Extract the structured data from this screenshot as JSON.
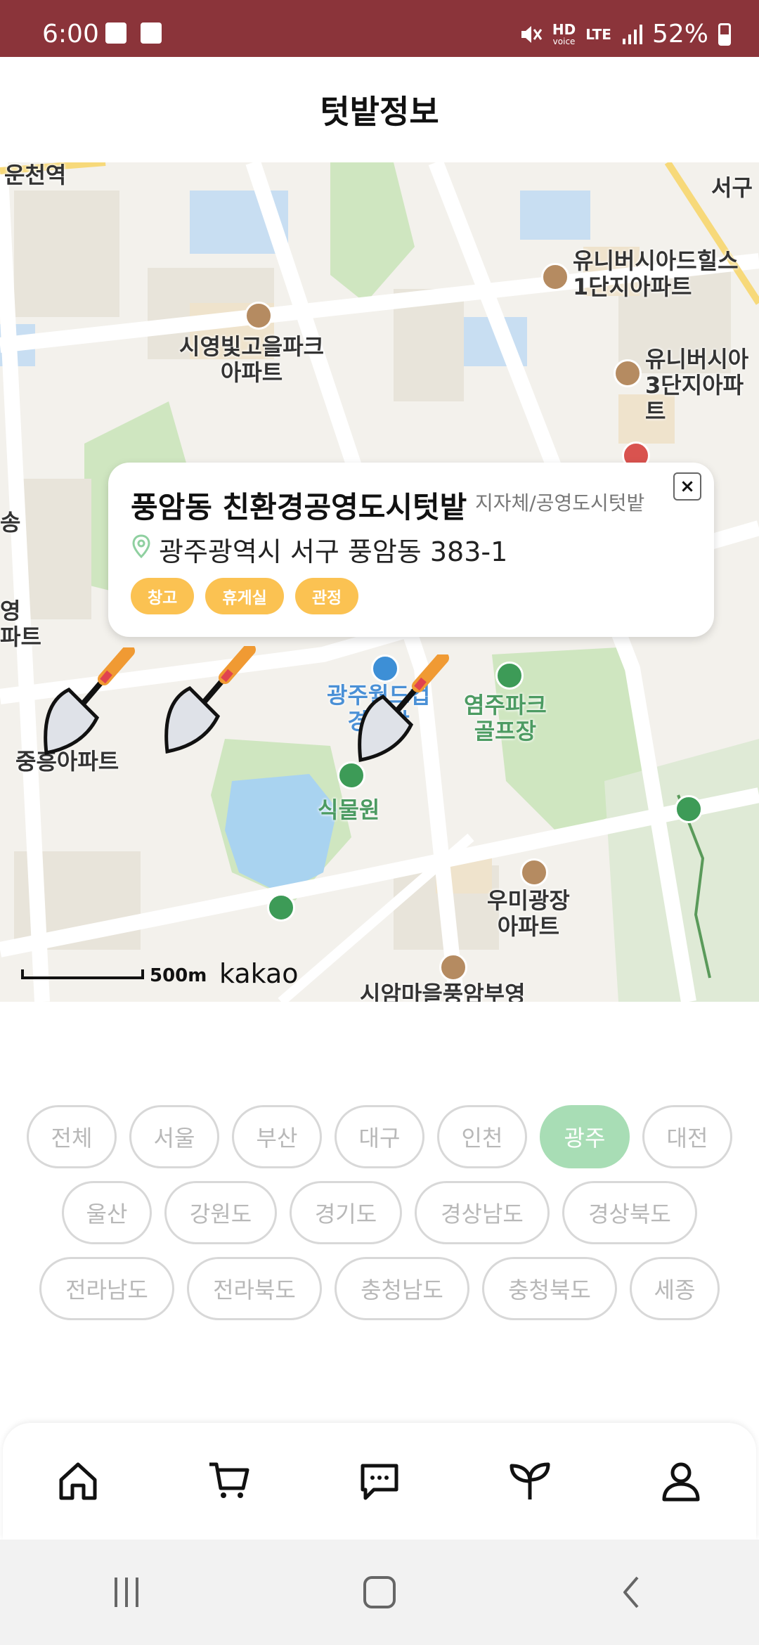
{
  "status_bar": {
    "time": "6:00",
    "hd_label": "HD",
    "voice_label": "voice",
    "lte_label": "LTE",
    "battery": "52%"
  },
  "header": {
    "title": "텃밭정보"
  },
  "map": {
    "labels": {
      "station": "운천역",
      "apt1": "시영빛고을파크\n아파트",
      "apt2": "유니버시아드힐스\n1단지아파트",
      "apt3": "유니버시아\n3단지아파트",
      "left1": "송",
      "left2": "영\n파트",
      "apt4": "중흥아파트",
      "stadium": "광주월드컵\n경기장",
      "golf": "염주파크\n골프장",
      "botanical": "식물원",
      "apt5": "우미광장\n아파트",
      "bottom_station": "시암마을풍암부영",
      "top_right": "서구"
    },
    "scale": "500m",
    "brand": "kakao"
  },
  "popup": {
    "name": "풍암동 친환경공영도시텃밭",
    "category": "지자체/공영도시텃밭",
    "address": "광주광역시 서구 풍암동 383-1",
    "close_icon": "×",
    "tags": [
      "창고",
      "휴게실",
      "관정"
    ]
  },
  "regions": {
    "row1": [
      "전체",
      "서울",
      "부산",
      "대구",
      "인천",
      "광주",
      "대전"
    ],
    "row2": [
      "울산",
      "강원도",
      "경기도",
      "경상남도",
      "경상북도"
    ],
    "row3": [
      "전라남도",
      "전라북도",
      "충청남도",
      "충청북도",
      "세종"
    ],
    "selected": "광주"
  },
  "bottom_nav": [
    "home-icon",
    "cart-icon",
    "chat-icon",
    "sprout-icon",
    "profile-icon"
  ],
  "colors": {
    "status_bar": "#8b343a",
    "tag": "#fbc252",
    "active_chip": "#a8ddb5"
  }
}
